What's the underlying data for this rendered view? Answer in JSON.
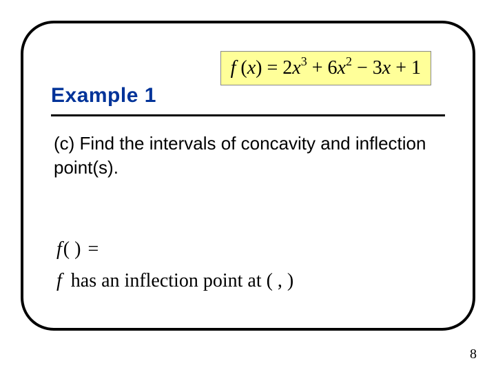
{
  "header": {
    "title": "Example 1",
    "equation_html": "f (x) = 2x³ + 6x² − 3x + 1"
  },
  "prompt": {
    "text": "(c) Find the intervals of concavity and inflection point(s)."
  },
  "math": {
    "line1_f": "f",
    "line1_paren": "(   )",
    "line1_eq": "=",
    "line2_f": "f",
    "line2_text": " has an inflection point at (    ,     )"
  },
  "page_number": "8"
}
